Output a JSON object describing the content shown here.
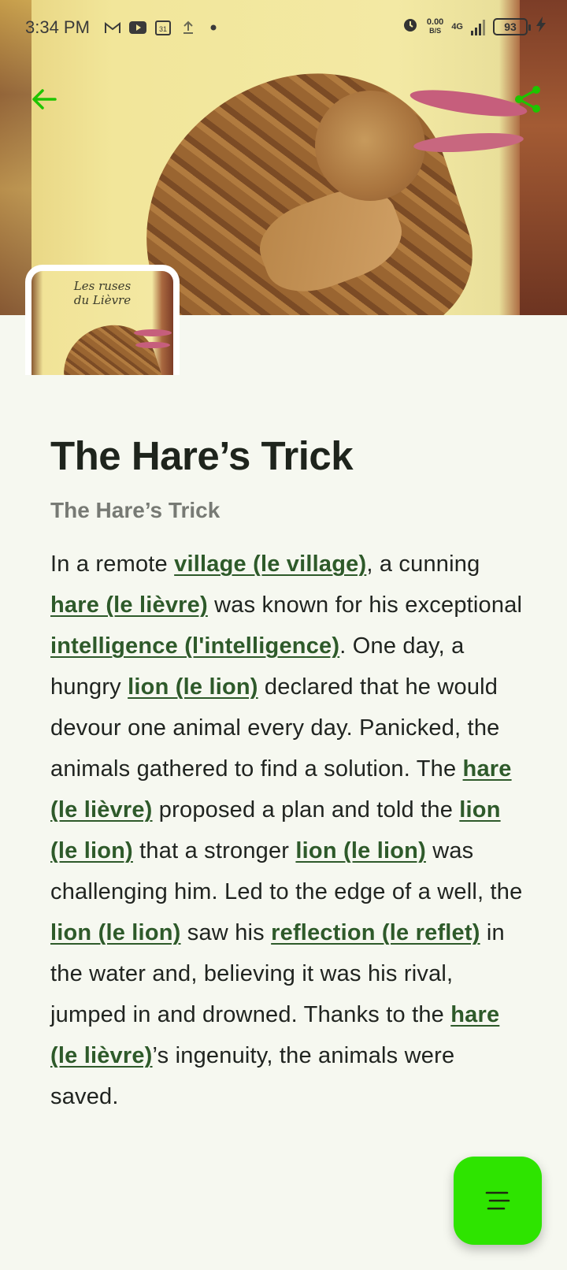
{
  "status_bar": {
    "time": "3:34 PM",
    "net_speed_value": "0.00",
    "net_speed_unit": "B/S",
    "network_type": "4G",
    "battery": "93"
  },
  "cover": {
    "title_line1": "Les ruses",
    "title_line2": "du Lièvre"
  },
  "story": {
    "title": "The Hare’s Trick",
    "subtitle": "The Hare’s Trick",
    "segments": [
      {
        "t": "In a remote "
      },
      {
        "t": "village (le village)",
        "v": true
      },
      {
        "t": ", a cunning "
      },
      {
        "t": "hare (le lièvre)",
        "v": true
      },
      {
        "t": " was known for his exceptional "
      },
      {
        "t": "intelligence (l'intelligence)",
        "v": true
      },
      {
        "t": ". One day, a hungry "
      },
      {
        "t": "lion (le lion)",
        "v": true
      },
      {
        "t": " declared that he would devour one animal every day. Panicked, the animals gathered to find a solution. The "
      },
      {
        "t": "hare (le lièvre)",
        "v": true
      },
      {
        "t": " proposed a plan and told the "
      },
      {
        "t": "lion (le lion)",
        "v": true
      },
      {
        "t": " that a stronger "
      },
      {
        "t": "lion (le lion)",
        "v": true
      },
      {
        "t": " was challenging him. Led to the edge of a well, the "
      },
      {
        "t": "lion (le lion)",
        "v": true
      },
      {
        "t": " saw his "
      },
      {
        "t": "reflection (le reflet)",
        "v": true
      },
      {
        "t": " in the water and, believing it was his rival, jumped in and drowned. Thanks to the "
      },
      {
        "t": "hare (le lièvre)",
        "v": true
      },
      {
        "t": "’s ingenuity, the animals were saved."
      }
    ]
  },
  "colors": {
    "accent": "#2ee400",
    "icon_green": "#1fc400",
    "vocab": "#2e5a2a",
    "background": "#f6f8f0"
  },
  "icons": {
    "back": "arrow-left-icon",
    "share": "share-icon",
    "fab": "menu-lines-icon"
  }
}
